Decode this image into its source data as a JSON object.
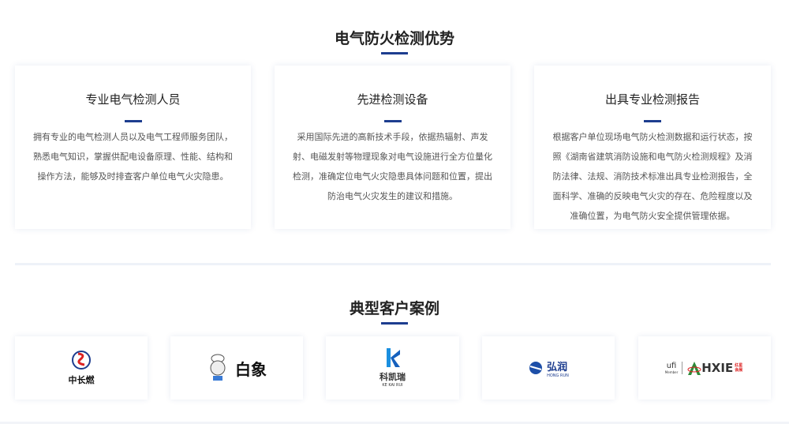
{
  "advantages": {
    "title": "电气防火检测优势",
    "cards": [
      {
        "title": "专业电气检测人员",
        "text": "拥有专业的电气检测人员以及电气工程师服务团队，熟悉电气知识，掌握供配电设备原理、性能、结构和操作方法，能够及时排查客户单位电气火灾隐患。"
      },
      {
        "title": "先进检测设备",
        "text": "采用国际先进的高新技术手段，依据热辐射、声发射、电磁发射等物理现象对电气设施进行全方位量化检测，准确定位电气火灾隐患具体问题和位置，提出防治电气火灾发生的建议和措施。"
      },
      {
        "title": "出具专业检测报告",
        "text": "根据客户单位现场电气防火检测数据和运行状态，按照《湖南省建筑消防设施和电气防火检测规程》及消防法律、法规、消防技术标准出具专业检测报告，全面科学、准确的反映电气火灾的存在、危险程度以及准确位置，为电气防火安全提供管理依据。"
      }
    ]
  },
  "cases": {
    "title": "典型客户案例",
    "logos": [
      {
        "name": "中长燃"
      },
      {
        "name": "白象"
      },
      {
        "name": "科凯瑞",
        "sub": "KE KAI RUI"
      },
      {
        "name": "弘润",
        "sub": "HONG RUN"
      },
      {
        "name": "HXIE",
        "ufi": "ufi",
        "member": "Member",
        "cn": "红星会展"
      }
    ]
  },
  "colors": {
    "accent": "#1d3d8f"
  }
}
